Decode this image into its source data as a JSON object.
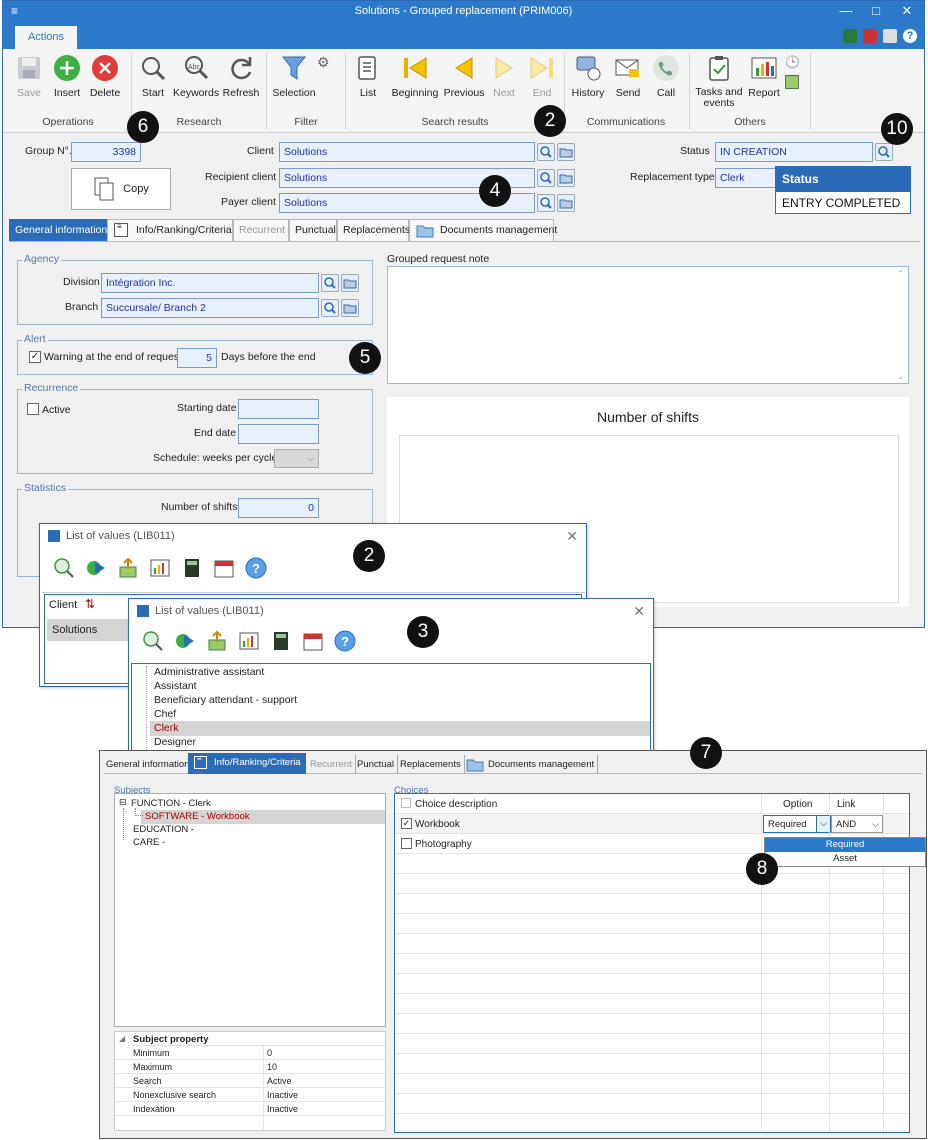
{
  "window": {
    "title": "Solutions - Grouped replacement (PRIM006)",
    "menu_glyph": "≡",
    "min_glyph": "—",
    "max_glyph": "□",
    "close_glyph": "✕"
  },
  "ribbon": {
    "tab_label": "Actions",
    "buttons": {
      "save": "Save",
      "insert": "Insert",
      "delete": "Delete",
      "start": "Start",
      "keywords": "Keywords",
      "refresh": "Refresh",
      "selection": "Selection",
      "list": "List",
      "beginning": "Beginning",
      "previous": "Previous",
      "next": "Next",
      "end": "End",
      "history": "History",
      "send": "Send",
      "call": "Call",
      "tasks": "Tasks and events",
      "report": "Report"
    },
    "groups": {
      "operations": "Operations",
      "research": "Research",
      "filter": "Filter",
      "search_results": "Search results",
      "communications": "Communications",
      "others": "Others"
    }
  },
  "callouts": {
    "c6": "6",
    "c2a": "2",
    "c10": "10",
    "c4": "4",
    "c5": "5",
    "c2b": "2",
    "c3": "3",
    "c7": "7",
    "c8": "8"
  },
  "header": {
    "group_no_label": "Group N°.",
    "group_no_value": "3398",
    "copy_label": "Copy",
    "client_label": "Client",
    "client_value": "Solutions",
    "recipient_label": "Recipient client",
    "recipient_value": "Solutions",
    "payer_label": "Payer client",
    "payer_value": "Solutions",
    "status_label": "Status",
    "status_value": "IN CREATION",
    "replacement_type_label": "Replacement type",
    "replacement_type_value": "Clerk",
    "status_popup_header": "Status",
    "status_popup_item": "ENTRY COMPLETED"
  },
  "tabs": [
    "General information",
    "Info/Ranking/Criteria",
    "Recurrent",
    "Punctual",
    "Replacements",
    "Documents management"
  ],
  "agency": {
    "title": "Agency",
    "division_label": "Division",
    "division_value": "Intégration Inc.",
    "branch_label": "Branch",
    "branch_value": "Succursale/ Branch 2"
  },
  "alert": {
    "title": "Alert",
    "warning_label": "Warning at the end of request",
    "days_value": "5",
    "days_label": "Days before the end"
  },
  "recurrence": {
    "title": "Recurrence",
    "active_label": "Active",
    "starting_label": "Starting date",
    "end_label": "End date",
    "schedule_label": "Schedule: weeks per cycle"
  },
  "statistics": {
    "title": "Statistics",
    "shifts_label": "Number of shifts",
    "shifts_value": "0"
  },
  "note": {
    "label": "Grouped request note",
    "chart_title": "Number of shifts"
  },
  "lov1": {
    "title": "List of values (LIB011)",
    "col_header": "Client",
    "sort_glyph": "⇅",
    "row": "Solutions"
  },
  "lov2": {
    "title": "List of values (LIB011)",
    "items": [
      "Administrative assistant",
      "Assistant",
      "Beneficiary attendant - support",
      "Chef",
      "Clerk",
      "Designer"
    ]
  },
  "bottom": {
    "subjects_title": "Subjects",
    "tree": {
      "function": "FUNCTION - Clerk",
      "software": "SOFTWARE - Workbook",
      "education": "EDUCATION -",
      "care": "CARE -",
      "collapse_glyph": "⊟"
    },
    "property": {
      "header": "Subject property",
      "rows": [
        {
          "k": "Minimum",
          "v": "0"
        },
        {
          "k": "Maximum",
          "v": "10"
        },
        {
          "k": "Search",
          "v": "Active"
        },
        {
          "k": "Nonexclusive search",
          "v": "Inactive"
        },
        {
          "k": "Indexation",
          "v": "Inactive"
        }
      ]
    },
    "choices_title": "Choices",
    "col_description": "Choice description",
    "col_option": "Option",
    "col_link": "Link",
    "workbook": "Workbook",
    "photography": "Photography",
    "option_value": "Required",
    "link_value": "AND",
    "dropdown_items": [
      "Required",
      "Asset"
    ]
  },
  "colors": {
    "accent": "#2b79c8",
    "field_bg": "#e8f0fb",
    "field_text": "#2233aa"
  }
}
